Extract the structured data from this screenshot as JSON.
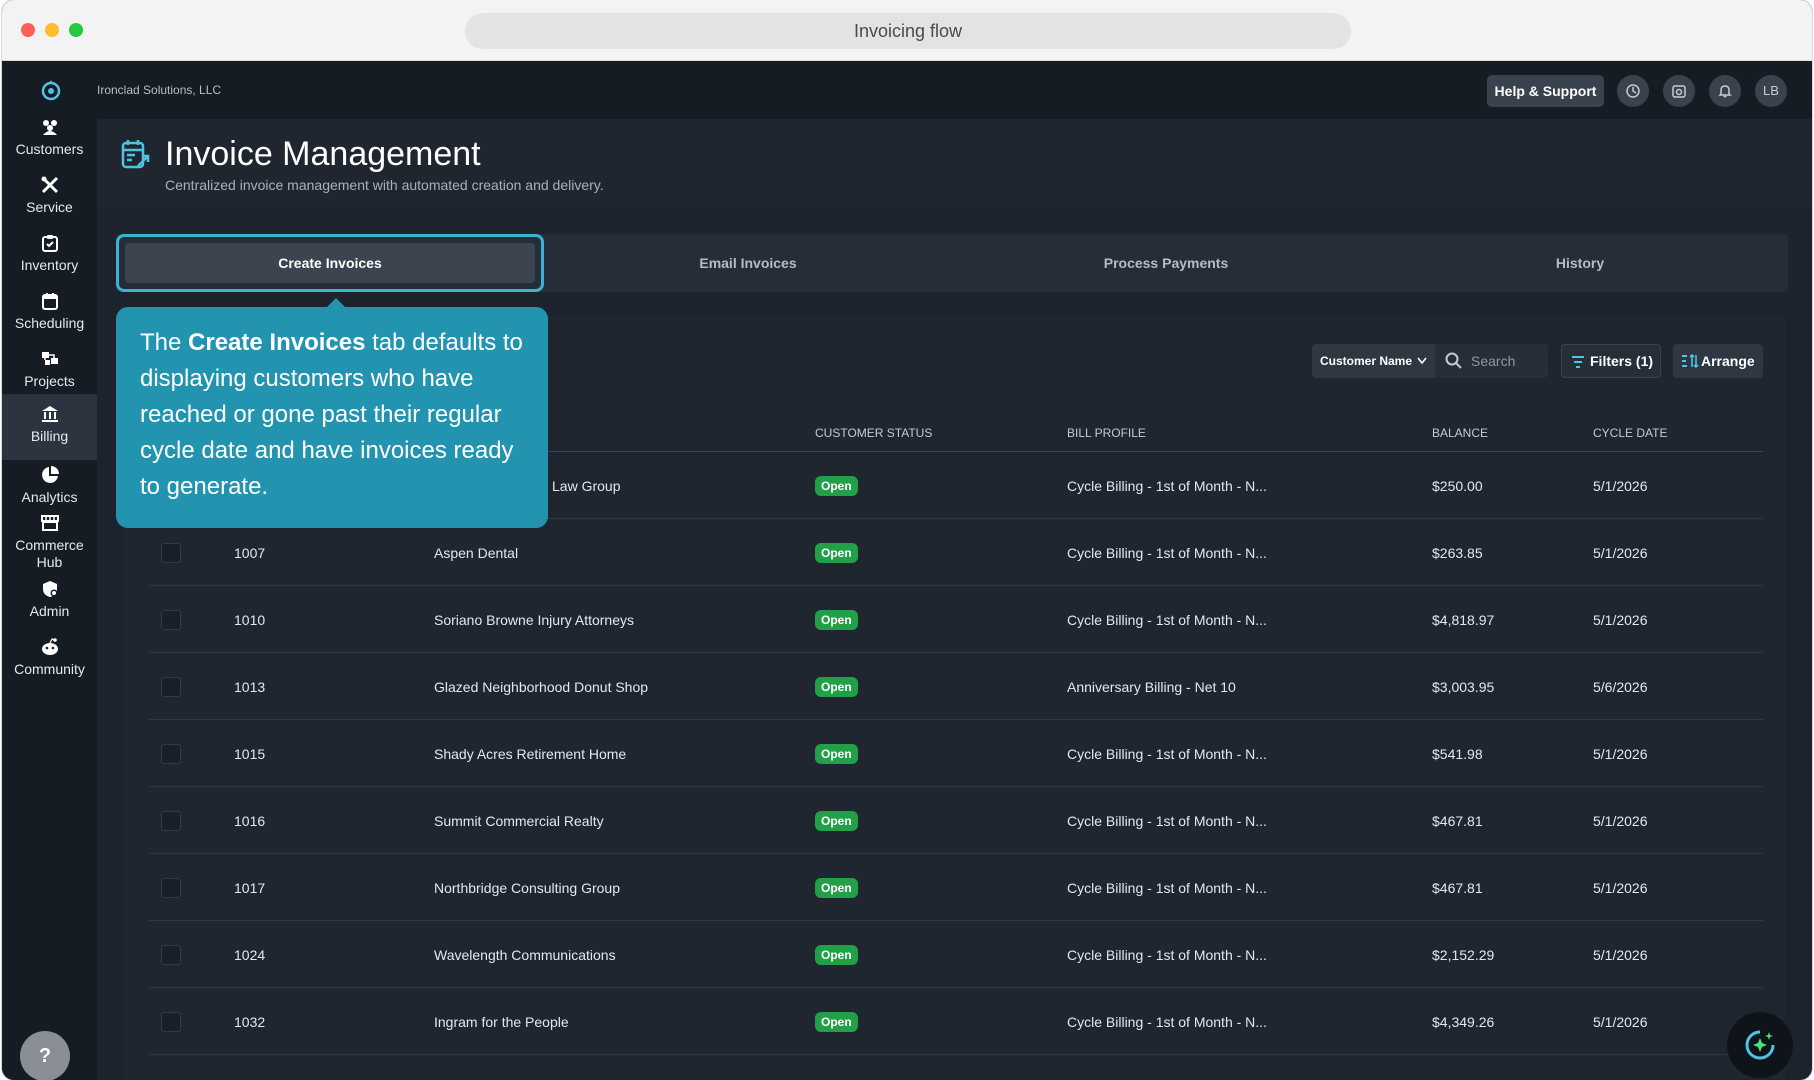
{
  "browser": {
    "title": "Invoicing flow"
  },
  "company": "Ironclad Solutions, LLC",
  "header": {
    "help_support": "Help & Support",
    "user_initials": "LB"
  },
  "sidebar": {
    "items": [
      {
        "label": "Customers",
        "icon": "customers-icon"
      },
      {
        "label": "Service",
        "icon": "tools-icon"
      },
      {
        "label": "Inventory",
        "icon": "clipboard-icon"
      },
      {
        "label": "Scheduling",
        "icon": "calendar-icon"
      },
      {
        "label": "Projects",
        "icon": "projects-icon"
      },
      {
        "label": "Billing",
        "icon": "bank-icon",
        "active": true
      },
      {
        "label": "Analytics",
        "icon": "pie-chart-icon"
      },
      {
        "label": "Commerce Hub",
        "icon": "store-icon"
      },
      {
        "label": "Admin",
        "icon": "admin-icon"
      },
      {
        "label": "Community",
        "icon": "community-icon"
      }
    ],
    "help": "?"
  },
  "page": {
    "title": "Invoice Management",
    "subtitle": "Centralized invoice management with automated creation and delivery."
  },
  "tabs": [
    {
      "label": "Create Invoices",
      "active": true
    },
    {
      "label": "Email Invoices"
    },
    {
      "label": "Process Payments"
    },
    {
      "label": "History"
    }
  ],
  "toolbar": {
    "select_value": "Customer Name",
    "search_placeholder": "Search",
    "filters_label": "Filters (1)",
    "arrange_label": "Arrange"
  },
  "callout": {
    "prefix": "The ",
    "bold": "Create Invoices",
    "suffix": " tab defaults to displaying customers who have reached or gone past their regular cycle date and have invoices ready to generate."
  },
  "table": {
    "columns": {
      "status": "CUSTOMER STATUS",
      "profile": "BILL PROFILE",
      "balance": "BALANCE",
      "cycle": "CYCLE DATE"
    },
    "rows": [
      {
        "id": "",
        "name": "Law Group",
        "status": "Open",
        "profile": "Cycle Billing - 1st of Month - N...",
        "balance": "$250.00",
        "cycle": "5/1/2026"
      },
      {
        "id": "1007",
        "name": "Aspen Dental",
        "status": "Open",
        "profile": "Cycle Billing - 1st of Month - N...",
        "balance": "$263.85",
        "cycle": "5/1/2026"
      },
      {
        "id": "1010",
        "name": "Soriano Browne Injury Attorneys",
        "status": "Open",
        "profile": "Cycle Billing - 1st of Month - N...",
        "balance": "$4,818.97",
        "cycle": "5/1/2026"
      },
      {
        "id": "1013",
        "name": "Glazed Neighborhood Donut Shop",
        "status": "Open",
        "profile": "Anniversary Billing - Net 10",
        "balance": "$3,003.95",
        "cycle": "5/6/2026"
      },
      {
        "id": "1015",
        "name": "Shady Acres Retirement Home",
        "status": "Open",
        "profile": "Cycle Billing - 1st of Month - N...",
        "balance": "$541.98",
        "cycle": "5/1/2026"
      },
      {
        "id": "1016",
        "name": "Summit Commercial Realty",
        "status": "Open",
        "profile": "Cycle Billing - 1st of Month - N...",
        "balance": "$467.81",
        "cycle": "5/1/2026"
      },
      {
        "id": "1017",
        "name": "Northbridge Consulting Group",
        "status": "Open",
        "profile": "Cycle Billing - 1st of Month - N...",
        "balance": "$467.81",
        "cycle": "5/1/2026"
      },
      {
        "id": "1024",
        "name": "Wavelength Communications",
        "status": "Open",
        "profile": "Cycle Billing - 1st of Month - N...",
        "balance": "$2,152.29",
        "cycle": "5/1/2026"
      },
      {
        "id": "1032",
        "name": "Ingram for the People",
        "status": "Open",
        "profile": "Cycle Billing - 1st of Month - N...",
        "balance": "$4,349.26",
        "cycle": "5/1/2026"
      }
    ]
  },
  "colors": {
    "accent": "#2394b0",
    "open_badge": "#22a047"
  }
}
